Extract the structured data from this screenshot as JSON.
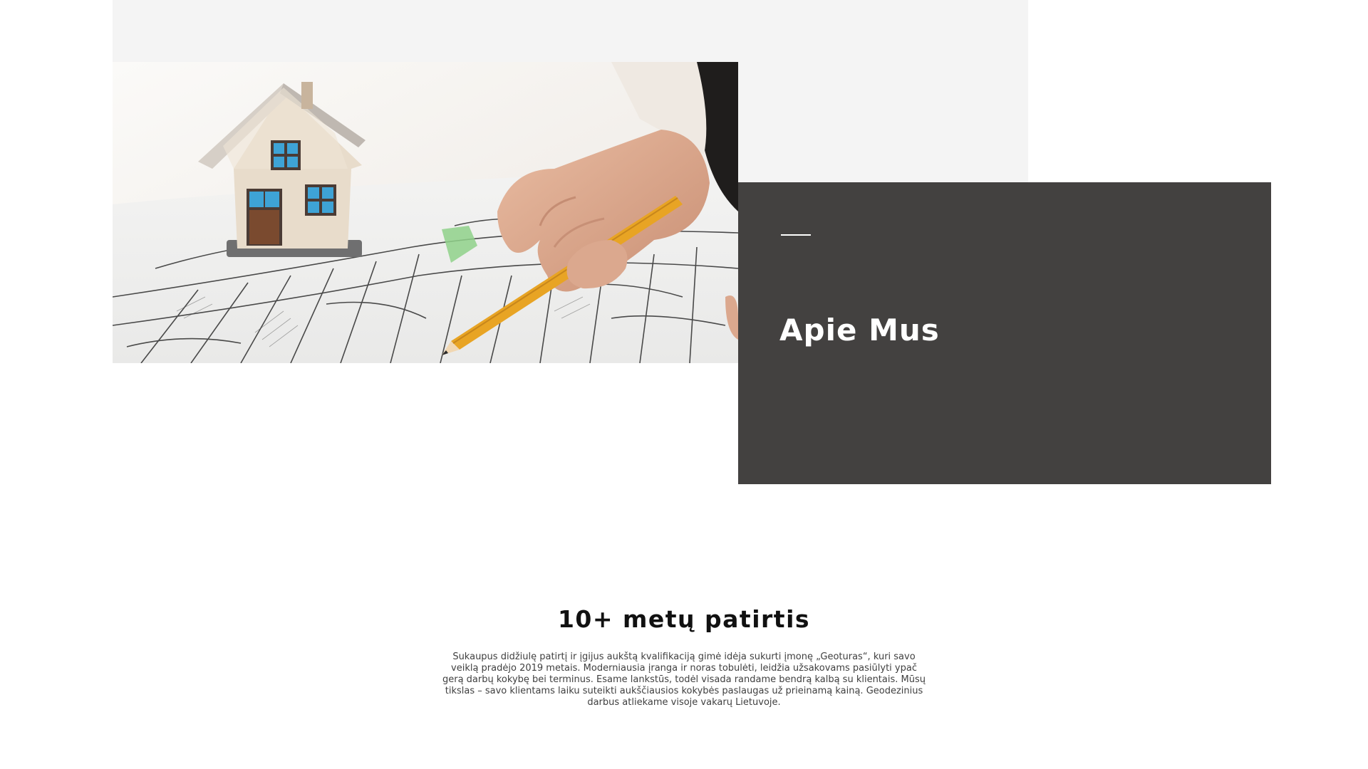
{
  "about": {
    "title": "Apie Mus"
  },
  "experience": {
    "heading": "10+ metų patirtis",
    "body": "Sukaupus didžiulę patirtį ir įgijus aukštą kvalifikaciją gimė idėja sukurti įmonę „Geoturas“, kuri savo veiklą pradėjo 2019 metais. Moderniausia įranga ir noras tobulėti, leidžia užsakovams pasiūlyti ypač gerą darbų kokybę bei terminus. Esame lankstūs, todėl visada randame bendrą kalbą su klientais. Mūsų tikslas – savo klientams laiku suteikti aukščiausios kokybės paslaugas už prieinamą kainą. Geodezinius darbus atliekame visoje vakarų Lietuvoje."
  },
  "colors": {
    "card_background": "#434140",
    "top_band": "#f4f4f4",
    "pencil": "#e8a424"
  },
  "hero_image": {
    "icon": "house-on-cadastral-map-photo"
  }
}
